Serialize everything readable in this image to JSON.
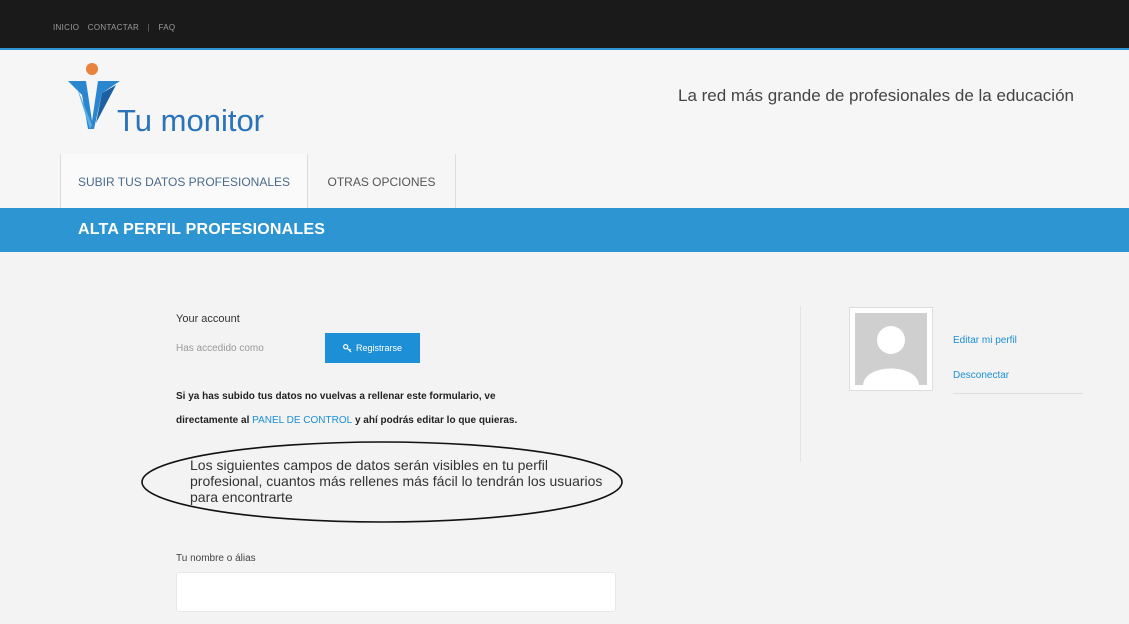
{
  "topnav": {
    "home": "INICIO",
    "contact": "CONTACTAR",
    "separator": "|",
    "faq": "FAQ"
  },
  "brand": {
    "logo_text": "Tu monitor",
    "tagline": "La red más grande de profesionales de la educación"
  },
  "tabs": [
    {
      "label": "SUBIR TUS DATOS PROFESIONALES"
    },
    {
      "label": "OTRAS OPCIONES"
    }
  ],
  "section": {
    "title": "ALTA PERFIL PROFESIONALES"
  },
  "account": {
    "label": "Your account",
    "status": "Has accedido como",
    "register_button": "Registrarse"
  },
  "info": {
    "line1": "Si ya has subido tus datos no vuelvas a rellenar este formulario, ve",
    "line2_pre": "directamente al ",
    "line2_link": "PANEL DE CONTROL",
    "line2_post": " y ahí podrás editar lo que quieras."
  },
  "notice": "Los siguientes campos de datos serán visibles en tu perfil profesional, cuantos más rellenes más fácil lo tendrán los usuarios para encontrarte",
  "form": {
    "name_label": "Tu nombre o álias",
    "name_value": ""
  },
  "profile": {
    "edit_link": "Editar mi perfil",
    "logout_link": "Desconectar"
  },
  "colors": {
    "accent": "#2e95d3",
    "topbar": "#1a1a1a",
    "button": "#1c8fd6",
    "brand": "#2a73b8"
  }
}
